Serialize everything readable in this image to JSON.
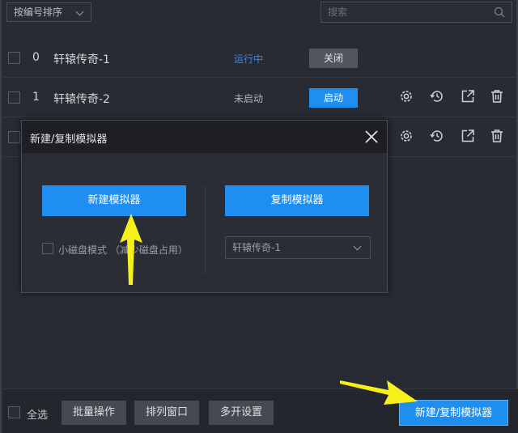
{
  "toolbar": {
    "sort_label": "按编号排序",
    "search_placeholder": "搜索"
  },
  "rows": [
    {
      "index": "0",
      "name": "轩辕传奇-1",
      "status": "运行中",
      "status_color": "#2d8cf0",
      "action": "关闭"
    },
    {
      "index": "1",
      "name": "轩辕传奇-2",
      "status": "未启动",
      "status_color": "#b0b2b8",
      "action": "启动"
    }
  ],
  "dialog": {
    "title": "新建/复制模拟器",
    "new_button": "新建模拟器",
    "copy_button": "复制模拟器",
    "small_disk_label": "小磁盘模式 （减少磁盘占用）",
    "source_value": "轩辕传奇-1"
  },
  "bottom": {
    "select_all": "全选",
    "batch": "批量操作",
    "arrange": "排列窗口",
    "multi_settings": "多开设置",
    "new_copy": "新建/复制模拟器"
  },
  "colors": {
    "accent": "#1f8ef1",
    "arrow": "#f5ef1a"
  }
}
